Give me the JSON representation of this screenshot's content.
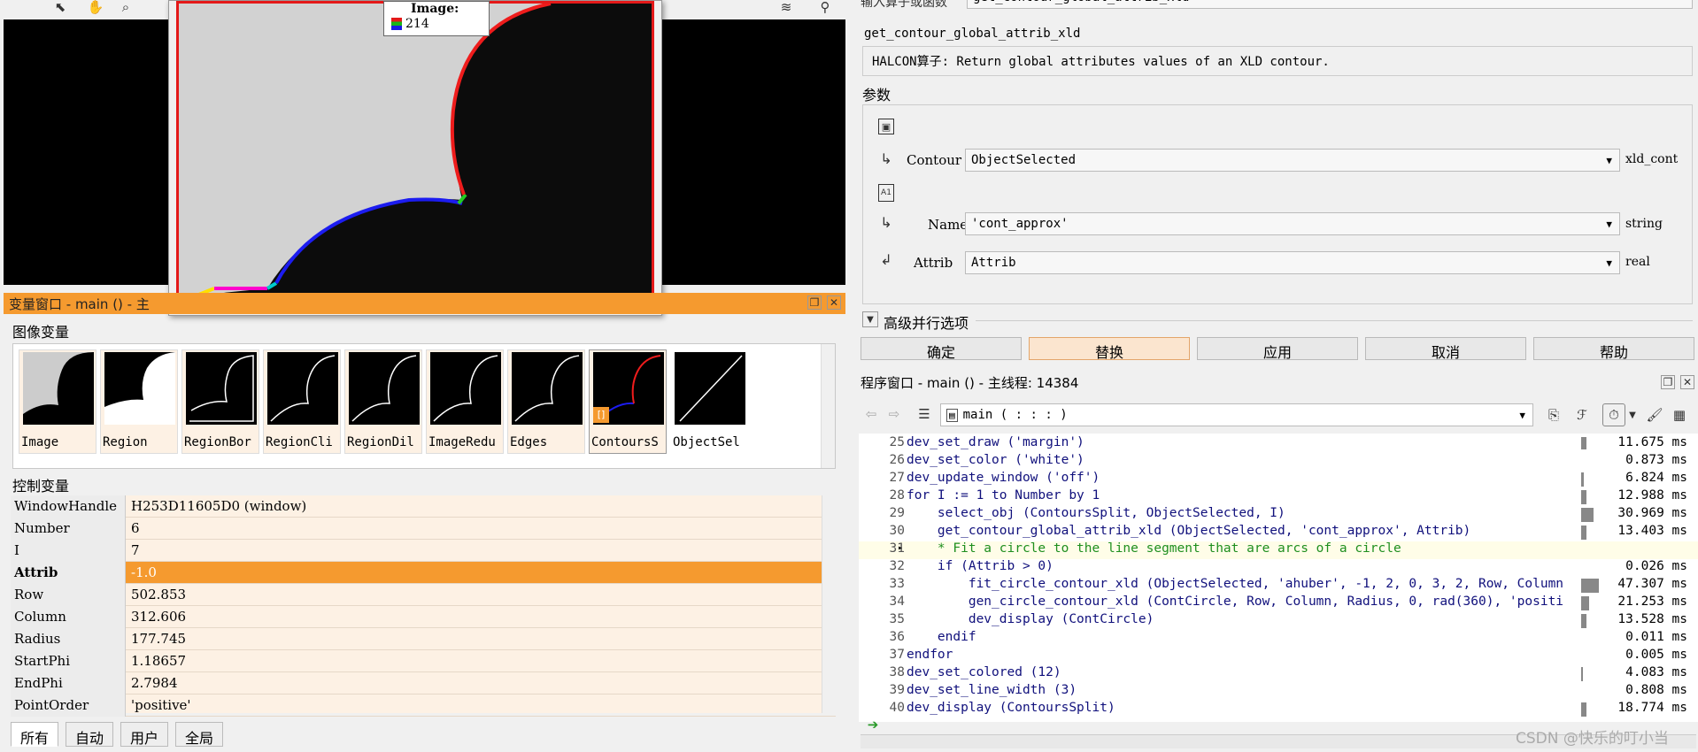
{
  "image_tip": {
    "label": "Image:",
    "value": "214"
  },
  "var_window": {
    "title": "变量窗口 - main () - 主",
    "image_vars_label": "图像变量",
    "images": [
      "Image",
      "Region",
      "RegionBor",
      "RegionCli",
      "RegionDil",
      "ImageRedu",
      "Edges",
      "ContoursS",
      "ObjectSel"
    ],
    "control_vars_label": "控制变量",
    "controls": [
      {
        "name": "WindowHandle",
        "value": "H253D11605D0 (window)"
      },
      {
        "name": "Number",
        "value": "6"
      },
      {
        "name": "I",
        "value": "7"
      },
      {
        "name": "Attrib",
        "value": "-1.0",
        "selected": true
      },
      {
        "name": "Row",
        "value": "502.853"
      },
      {
        "name": "Column",
        "value": "312.606"
      },
      {
        "name": "Radius",
        "value": "177.745"
      },
      {
        "name": "StartPhi",
        "value": "1.18657"
      },
      {
        "name": "EndPhi",
        "value": "2.7984"
      },
      {
        "name": "PointOrder",
        "value": "'positive'"
      }
    ],
    "tabs": [
      "所有",
      "自动",
      "用户",
      "全局"
    ]
  },
  "operator": {
    "top_label": "输入算子或函数",
    "top_value": "get_contour_global_attrib_xld",
    "name": "get_contour_global_attrib_xld",
    "description": "HALCON算子: Return global attributes values of an XLD contour.",
    "params_label": "参数",
    "params": [
      {
        "label": "Contour",
        "value": "ObjectSelected",
        "type": "xld_cont"
      },
      {
        "label": "Name",
        "value": "'cont_approx'",
        "type": "string"
      },
      {
        "label": "Attrib",
        "value": "Attrib",
        "type": "real"
      }
    ],
    "advanced_label": "高级并行选项",
    "buttons": [
      "确定",
      "替换",
      "应用",
      "取消",
      "帮助"
    ]
  },
  "program": {
    "title": "程序窗口 - main () - 主线程: 14384",
    "proc_selector": "main ( : : : )",
    "lines": [
      {
        "n": "25",
        "code": "dev_set_draw ('margin')",
        "time": "11.675 ms"
      },
      {
        "n": "26",
        "code": "dev_set_color ('white')",
        "time": "0.873 ms"
      },
      {
        "n": "27",
        "code": "dev_update_window ('off')",
        "time": "6.824 ms"
      },
      {
        "n": "28",
        "code": "for I := 1 to Number by 1",
        "time": "12.988 ms"
      },
      {
        "n": "29",
        "code": "    select_obj (ContoursSplit, ObjectSelected, I)",
        "time": "30.969 ms"
      },
      {
        "n": "30",
        "code": "    get_contour_global_attrib_xld (ObjectSelected, 'cont_approx', Attrib)",
        "time": "13.403 ms"
      },
      {
        "n": "31",
        "code": "    * Fit a circle to the line segment that are arcs of a circle",
        "time": "",
        "comment": true
      },
      {
        "n": "32",
        "code": "    if (Attrib > 0)",
        "time": "0.026 ms"
      },
      {
        "n": "33",
        "code": "        fit_circle_contour_xld (ObjectSelected, 'ahuber', -1, 2, 0, 3, 2, Row, Column",
        "time": "47.307 ms"
      },
      {
        "n": "34",
        "code": "        gen_circle_contour_xld (ContCircle, Row, Column, Radius, 0, rad(360), 'positi",
        "time": "21.253 ms"
      },
      {
        "n": "35",
        "code": "        dev_display (ContCircle)",
        "time": "13.528 ms"
      },
      {
        "n": "36",
        "code": "    endif",
        "time": "0.011 ms"
      },
      {
        "n": "37",
        "code": "endfor",
        "time": "0.005 ms"
      },
      {
        "n": "38",
        "code": "dev_set_colored (12)",
        "time": "4.083 ms"
      },
      {
        "n": "39",
        "code": "dev_set_line_width (3)",
        "time": "0.808 ms"
      },
      {
        "n": "40",
        "code": "dev_display (ContoursSplit)",
        "time": "18.774 ms"
      }
    ]
  },
  "watermark": "CSDN @快乐的叮小当"
}
